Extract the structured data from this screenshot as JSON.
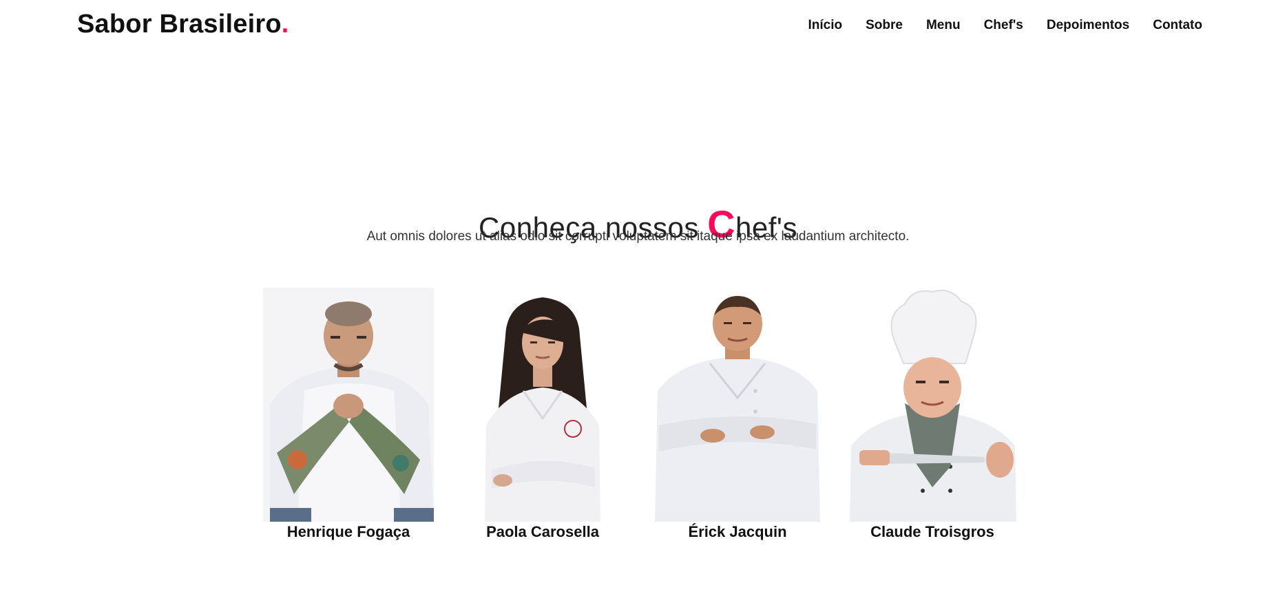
{
  "brand": {
    "name": "Sabor Brasileiro",
    "dot": ".",
    "accent_color": "#ff0a5a"
  },
  "nav": {
    "items": [
      {
        "label": "Início"
      },
      {
        "label": "Sobre"
      },
      {
        "label": "Menu"
      },
      {
        "label": "Chef's"
      },
      {
        "label": "Depoimentos"
      },
      {
        "label": "Contato"
      }
    ]
  },
  "section": {
    "title_prefix": "Conheça nossos ",
    "title_accent": "C",
    "title_suffix": "hef's",
    "subtitle": "Aut omnis dolores ut alias odio sit corrupti voluptatem sit itaque ipsa ex laudantium architecto."
  },
  "chefs": [
    {
      "name": "Henrique Fogaça",
      "photo": "chef-photo-bald-tattooed"
    },
    {
      "name": "Paola Carosella",
      "photo": "chef-photo-dark-hair-arms-crossed"
    },
    {
      "name": "Érick Jacquin",
      "photo": "chef-photo-arms-crossed"
    },
    {
      "name": "Claude Troisgros",
      "photo": "chef-photo-toque-knife"
    }
  ]
}
